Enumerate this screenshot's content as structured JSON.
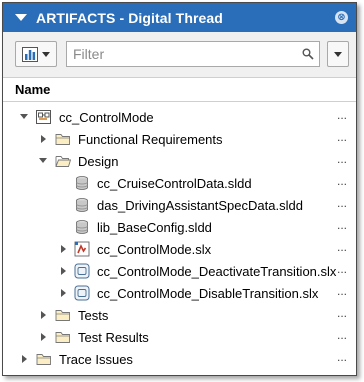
{
  "panel": {
    "title": "ARTIFACTS - Digital Thread",
    "close_glyph": "⊗"
  },
  "toolbar": {
    "view_button_icon": "bar-chart-icon",
    "filter_placeholder": "Filter",
    "filter_value": "",
    "search_icon": "search-icon"
  },
  "header": {
    "name_label": "Name"
  },
  "tree": [
    {
      "label": "cc_ControlMode",
      "icon": "project-icon",
      "expander": "expanded",
      "more": "..."
    },
    {
      "label": "Functional Requirements",
      "icon": "folder-icon",
      "expander": "collapsed",
      "more": "..."
    },
    {
      "label": "Design",
      "icon": "folder-icon",
      "expander": "expanded",
      "more": "..."
    },
    {
      "label": "cc_CruiseControlData.sldd",
      "icon": "data-dictionary-icon",
      "expander": "none",
      "more": "..."
    },
    {
      "label": "das_DrivingAssistantSpecData.sldd",
      "icon": "data-dictionary-icon",
      "expander": "none",
      "more": "..."
    },
    {
      "label": "lib_BaseConfig.sldd",
      "icon": "data-dictionary-icon",
      "expander": "none",
      "more": "..."
    },
    {
      "label": "cc_ControlMode.slx",
      "icon": "simulink-model-icon",
      "expander": "collapsed",
      "more": "..."
    },
    {
      "label": "cc_ControlMode_DeactivateTransition.slx",
      "icon": "simulink-subsystem-icon",
      "expander": "collapsed",
      "more": "..."
    },
    {
      "label": "cc_ControlMode_DisableTransition.slx",
      "icon": "simulink-subsystem-icon",
      "expander": "collapsed",
      "more": "..."
    },
    {
      "label": "Tests",
      "icon": "folder-icon",
      "expander": "collapsed",
      "more": "..."
    },
    {
      "label": "Test Results",
      "icon": "folder-icon",
      "expander": "collapsed",
      "more": "..."
    },
    {
      "label": "Trace Issues",
      "icon": "folder-icon",
      "expander": "collapsed",
      "more": "..."
    }
  ]
}
